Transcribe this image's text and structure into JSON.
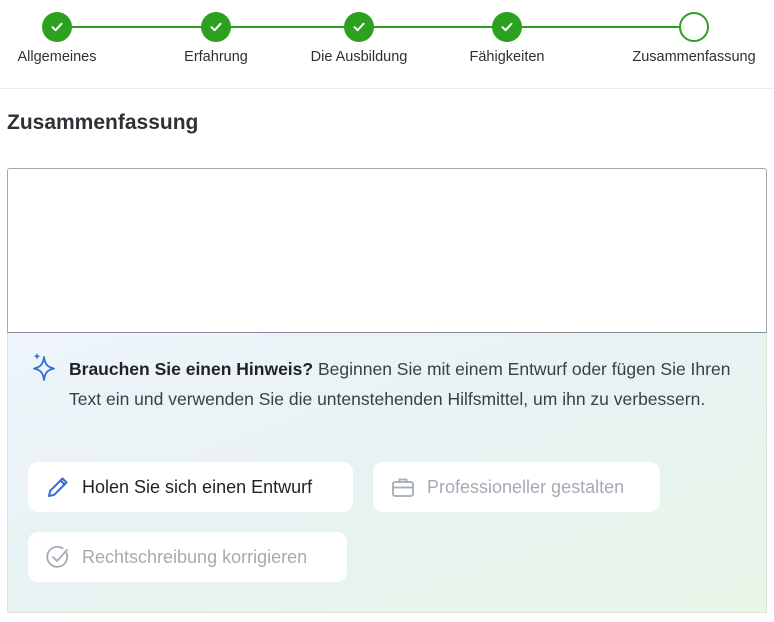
{
  "stepper": {
    "steps": [
      {
        "label": "Allgemeines",
        "state": "done"
      },
      {
        "label": "Erfahrung",
        "state": "done"
      },
      {
        "label": "Die Ausbildung",
        "state": "done"
      },
      {
        "label": "Fähigkeiten",
        "state": "done"
      },
      {
        "label": "Zusammenfassung",
        "state": "current"
      }
    ]
  },
  "section": {
    "title": "Zusammenfassung"
  },
  "editor": {
    "value": "",
    "placeholder": ""
  },
  "hint": {
    "lead": "Brauchen Sie einen Hinweis?",
    "text": " Beginnen Sie mit einem Entwurf oder fügen Sie Ihren Text ein und verwenden Sie die untenstehenden Hilfsmittel, um ihn zu verbessern."
  },
  "actions": {
    "draft": {
      "label": "Holen Sie sich einen Entwurf",
      "icon": "pencil-icon",
      "enabled": true
    },
    "professional": {
      "label": "Professioneller gestalten",
      "icon": "briefcase-icon",
      "enabled": false
    },
    "spelling": {
      "label": "Rechtschreibung korrigieren",
      "icon": "check-circle-icon",
      "enabled": false
    }
  },
  "colors": {
    "accent": "#2ea01f",
    "sparkle": "#2f6fd6",
    "disabled_text": "#a4abb4"
  }
}
